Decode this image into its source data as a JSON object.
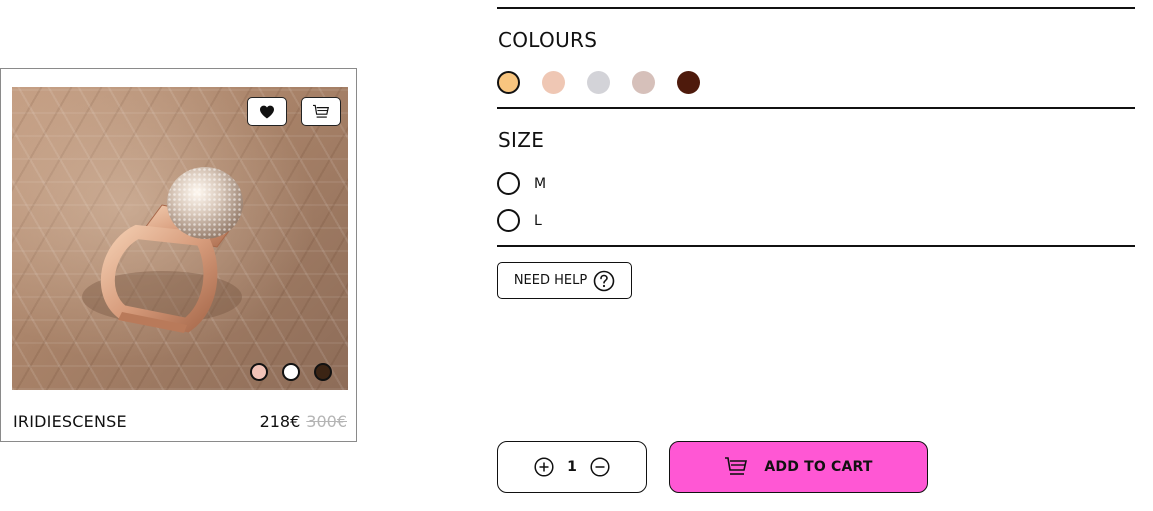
{
  "product": {
    "name": "IRIDIESCENSE",
    "price": "218€",
    "old_price": "300€",
    "image_swatches": [
      {
        "color": "#f1c3b8"
      },
      {
        "color": "#ffffff"
      },
      {
        "color": "#3b2414"
      }
    ]
  },
  "actions": {
    "favorite_icon": "heart-icon",
    "cart_icon": "cart-icon"
  },
  "colours": {
    "title": "COLOURS",
    "options": [
      {
        "color": "#f8c57f",
        "selected": true
      },
      {
        "color": "#efc7b4",
        "selected": false
      },
      {
        "color": "#d3d3d8",
        "selected": false
      },
      {
        "color": "#d6c0ba",
        "selected": false
      },
      {
        "color": "#4e1a0c",
        "selected": false
      }
    ]
  },
  "size": {
    "title": "SIZE",
    "options": [
      {
        "label": "M",
        "selected": false
      },
      {
        "label": "L",
        "selected": false
      }
    ]
  },
  "help": {
    "label": "NEED HELP",
    "icon": "question-circle-icon"
  },
  "quantity": {
    "value": "1",
    "increase_icon": "plus-circle-icon",
    "decrease_icon": "minus-circle-icon"
  },
  "add_to_cart": {
    "label": "ADD TO CART",
    "color": "#ff57d4",
    "icon": "cart-icon"
  }
}
